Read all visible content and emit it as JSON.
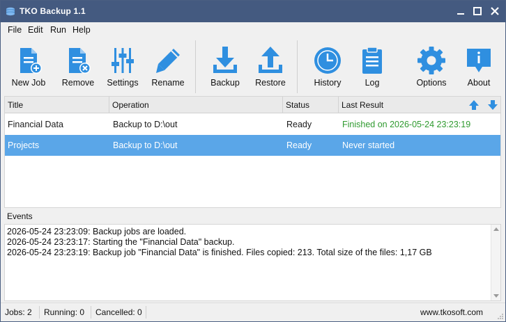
{
  "window": {
    "title": "TKO Backup 1.1"
  },
  "menu": [
    "File",
    "Edit",
    "Run",
    "Help"
  ],
  "toolbar": {
    "new_job": "New Job",
    "remove": "Remove",
    "settings": "Settings",
    "rename": "Rename",
    "backup": "Backup",
    "restore": "Restore",
    "history": "History",
    "log": "Log",
    "options": "Options",
    "about": "About"
  },
  "jobs": {
    "columns": [
      "Title",
      "Operation",
      "Status",
      "Last Result"
    ],
    "rows": [
      {
        "title": "Financial Data",
        "operation": "Backup to D:\\out",
        "status": "Ready",
        "last_result": "Finished on 2026-05-24 23:23:19"
      },
      {
        "title": "Projects",
        "operation": "Backup to D:\\out",
        "status": "Ready",
        "last_result": "Never started"
      }
    ]
  },
  "events": {
    "label": "Events",
    "lines": [
      "2026-05-24 23:23:09: Backup jobs are loaded.",
      "2026-05-24 23:23:17: Starting the \"Financial Data\" backup.",
      "2026-05-24 23:23:19: Backup job \"Financial Data\" is finished. Files copied: 213. Total size of the files: 1,17 GB"
    ]
  },
  "status": {
    "jobs": "Jobs: 2",
    "running": "Running: 0",
    "cancelled": "Cancelled: 0",
    "website": "www.tkosoft.com"
  },
  "colors": {
    "titlebar": "#445a80",
    "icon_blue": "#2f8fe0",
    "selection": "#5aa6e8",
    "success_text": "#2f9a2f"
  },
  "icons": [
    "app-icon",
    "new-job-icon",
    "remove-icon",
    "settings-icon",
    "rename-icon",
    "backup-icon",
    "restore-icon",
    "history-icon",
    "log-icon",
    "options-icon",
    "about-icon",
    "move-up-icon",
    "move-down-icon"
  ]
}
